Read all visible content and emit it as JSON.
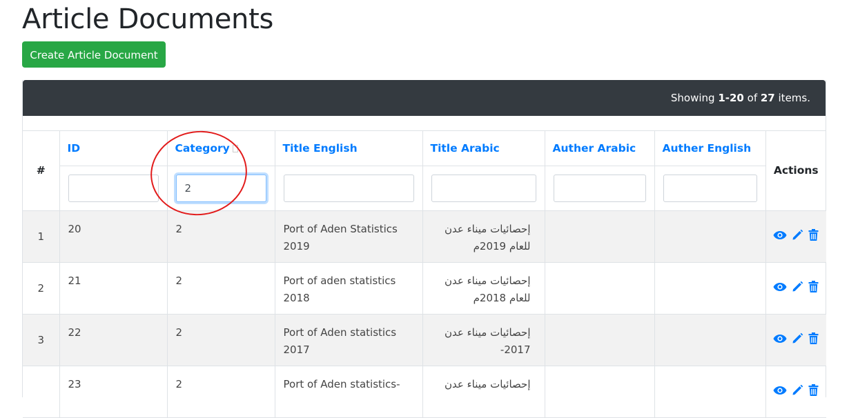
{
  "page": {
    "title": "Article Documents"
  },
  "toolbar": {
    "create_label": "Create Article Document"
  },
  "summary": {
    "prefix": "Showing ",
    "range": "1-20",
    "middle": " of ",
    "total": "27",
    "suffix": " items."
  },
  "table": {
    "hash_header": "#",
    "actions_header": "Actions",
    "columns": [
      "ID",
      "Category",
      "Title English",
      "Title Arabic",
      "Auther Arabic",
      "Auther English"
    ],
    "filters": [
      "",
      "2",
      "",
      "",
      "",
      ""
    ],
    "rows": [
      {
        "num": "1",
        "id": "20",
        "category": "2",
        "title_en": "Port of Aden Statistics 2019",
        "title_ar": "إحصائيات ميناء عدن للعام 2019م",
        "auth_ar": "",
        "auth_en": ""
      },
      {
        "num": "2",
        "id": "21",
        "category": "2",
        "title_en": "Port of aden statistics 2018",
        "title_ar": "إحصائيات ميناء عدن للعام 2018م",
        "auth_ar": "",
        "auth_en": ""
      },
      {
        "num": "3",
        "id": "22",
        "category": "2",
        "title_en": "Port of Aden statistics 2017",
        "title_ar": "إحصائيات ميناء عدن 2017-",
        "auth_ar": "",
        "auth_en": ""
      },
      {
        "num": "",
        "id": "23",
        "category": "2",
        "title_en": "Port of Aden statistics-",
        "title_ar": "إحصائيات ميناء عدن",
        "auth_ar": "",
        "auth_en": ""
      }
    ]
  },
  "icons": {
    "view": "eye-icon",
    "edit": "pencil-icon",
    "delete": "trash-icon"
  },
  "colors": {
    "link": "#007bff",
    "create": "#28a745",
    "summary_bg": "#343a40",
    "annotation": "#e21b1b"
  }
}
